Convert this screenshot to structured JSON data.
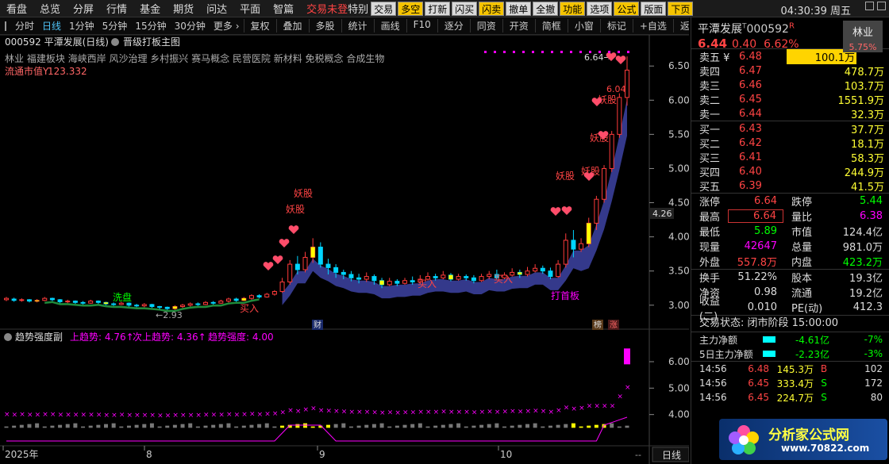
{
  "menubar": {
    "items": [
      "看盘",
      "总览",
      "分屏",
      "行情",
      "基金",
      "期货",
      "问达",
      "平面",
      "智篇"
    ],
    "trade_label": "交易",
    "trade_status": "未登",
    "trade_special": "特别",
    "toolbar": [
      {
        "label": "交易",
        "bg": "#d9d9d9"
      },
      {
        "label": "多空",
        "bg": "#f5c400"
      },
      {
        "label": "打新",
        "bg": "#d9d9d9"
      },
      {
        "label": "闪买",
        "bg": "#d9d9d9"
      },
      {
        "label": "闪卖",
        "bg": "#f5c400"
      },
      {
        "label": "撤单",
        "bg": "#d9d9d9"
      },
      {
        "label": "全撤",
        "bg": "#d9d9d9"
      },
      {
        "label": "功能",
        "bg": "#f5c400"
      },
      {
        "label": "选项",
        "bg": "#d9d9d9"
      },
      {
        "label": "公式",
        "bg": "#f5c400"
      },
      {
        "label": "版面",
        "bg": "#d9d9d9"
      },
      {
        "label": "下页",
        "bg": "#f5c400"
      }
    ],
    "clock": "04:30:39 周五"
  },
  "periodbar": {
    "periods": [
      "分时",
      "日线",
      "1分钟",
      "5分钟",
      "15分钟",
      "30分钟",
      "更多 ›"
    ],
    "active": "日线",
    "tools": [
      "复权",
      "叠加",
      "多股",
      "统计",
      "画线",
      "F10",
      "逐分",
      "同资",
      "开资",
      "简框",
      "小窗",
      "标记",
      "+自选",
      "返回"
    ]
  },
  "chart_info": {
    "code_name": "000592 平潭发展(日线)",
    "formula": "晋级打板主图",
    "concepts": "林业 福建板块 海峡西岸 风沙治理 乡村振兴 赛马概念 民营医院 新材料 免税概念 合成生物",
    "market_cap_label": "流通市值Y",
    "market_cap_value": "123.332",
    "price_now": "4.26",
    "high_label": "6.64",
    "low_label": "2.93",
    "mark_604": "6.04"
  },
  "annotations": {
    "yaogu": "妖股",
    "buy": "买入",
    "xipan": "洗盘",
    "dashouban": "打首板",
    "cai": "财",
    "bang": "榜",
    "zhang": "涨"
  },
  "indicator": {
    "name": "趋势强度副",
    "up_label": "上趋势:",
    "up_value": "4.76↑",
    "next_label": "次上趋势:",
    "next_value": "4.36↑",
    "strength_label": "趋势强度:",
    "strength_value": "4.00"
  },
  "axis": {
    "main_ticks": [
      "6.50",
      "6.00",
      "5.50",
      "5.00",
      "4.50",
      "4.00",
      "3.50",
      "3.00"
    ],
    "sub_ticks": [
      "6.00",
      "5.00",
      "4.00"
    ],
    "x_labels": [
      "2025年",
      "8",
      "9",
      "10"
    ],
    "period_label": "日线",
    "pager": "--"
  },
  "chart_data": {
    "type": "candlestick",
    "ylim": [
      2.8,
      6.7
    ],
    "candles": [
      [
        3.08,
        3.1,
        3.06,
        3.12
      ],
      [
        3.09,
        3.07,
        3.05,
        3.11
      ],
      [
        3.07,
        3.08,
        3.05,
        3.1
      ],
      [
        3.08,
        3.06,
        3.04,
        3.09
      ],
      [
        3.06,
        3.07,
        3.04,
        3.09
      ],
      [
        3.07,
        3.1,
        3.06,
        3.12
      ],
      [
        3.1,
        3.08,
        3.06,
        3.11
      ],
      [
        3.08,
        3.05,
        3.03,
        3.09
      ],
      [
        3.05,
        3.06,
        3.03,
        3.08
      ],
      [
        3.06,
        3.04,
        3.02,
        3.07
      ],
      [
        3.04,
        3.03,
        3.01,
        3.06
      ],
      [
        3.03,
        3.06,
        3.02,
        3.08
      ],
      [
        3.06,
        3.04,
        3.02,
        3.07
      ],
      [
        3.04,
        3.02,
        3.0,
        3.05
      ],
      [
        3.02,
        3.01,
        2.99,
        3.04
      ],
      [
        3.01,
        3.03,
        3.0,
        3.05
      ],
      [
        3.03,
        3.0,
        2.98,
        3.04
      ],
      [
        3.0,
        2.99,
        2.97,
        3.02
      ],
      [
        2.99,
        3.01,
        2.97,
        3.03
      ],
      [
        3.01,
        2.98,
        2.96,
        3.02
      ],
      [
        2.98,
        2.97,
        2.94,
        2.99
      ],
      [
        2.97,
        2.95,
        2.93,
        2.98
      ],
      [
        2.95,
        2.98,
        2.93,
        3.0
      ],
      [
        2.98,
        3.0,
        2.96,
        3.02
      ],
      [
        3.0,
        3.02,
        2.98,
        3.04
      ],
      [
        3.02,
        3.01,
        2.99,
        3.04
      ],
      [
        3.01,
        3.04,
        3.0,
        3.06
      ],
      [
        3.04,
        3.03,
        3.01,
        3.06
      ],
      [
        3.03,
        3.06,
        3.02,
        3.08
      ],
      [
        3.06,
        3.09,
        3.04,
        3.11
      ],
      [
        3.09,
        3.07,
        3.05,
        3.11
      ],
      [
        3.07,
        3.1,
        3.06,
        3.12
      ],
      [
        3.1,
        3.14,
        3.08,
        3.16
      ],
      [
        3.14,
        3.12,
        3.1,
        3.16
      ],
      [
        3.12,
        3.16,
        3.11,
        3.18
      ],
      [
        3.16,
        3.2,
        3.14,
        3.22
      ],
      [
        3.2,
        3.34,
        3.18,
        3.4
      ],
      [
        3.34,
        3.6,
        3.3,
        3.66
      ],
      [
        3.6,
        3.52,
        3.45,
        3.72
      ],
      [
        3.52,
        3.7,
        3.48,
        3.78
      ],
      [
        3.7,
        3.85,
        3.62,
        3.98
      ],
      [
        3.85,
        3.6,
        3.55,
        3.92
      ],
      [
        3.6,
        3.55,
        3.45,
        3.68
      ],
      [
        3.55,
        3.48,
        3.4,
        3.6
      ],
      [
        3.48,
        3.45,
        3.38,
        3.52
      ],
      [
        3.45,
        3.4,
        3.35,
        3.5
      ],
      [
        3.4,
        3.38,
        3.32,
        3.46
      ],
      [
        3.38,
        3.42,
        3.34,
        3.48
      ],
      [
        3.42,
        3.36,
        3.3,
        3.45
      ],
      [
        3.36,
        3.3,
        3.25,
        3.4
      ],
      [
        3.3,
        3.35,
        3.28,
        3.4
      ],
      [
        3.35,
        3.32,
        3.28,
        3.38
      ],
      [
        3.32,
        3.36,
        3.3,
        3.4
      ],
      [
        3.36,
        3.34,
        3.3,
        3.42
      ],
      [
        3.34,
        3.38,
        3.32,
        3.44
      ],
      [
        3.38,
        3.42,
        3.36,
        3.48
      ],
      [
        3.42,
        3.4,
        3.36,
        3.46
      ],
      [
        3.4,
        3.44,
        3.38,
        3.5
      ],
      [
        3.44,
        3.38,
        3.35,
        3.47
      ],
      [
        3.38,
        3.42,
        3.36,
        3.46
      ],
      [
        3.42,
        3.4,
        3.36,
        3.45
      ],
      [
        3.4,
        3.36,
        3.32,
        3.44
      ],
      [
        3.36,
        3.42,
        3.34,
        3.46
      ],
      [
        3.42,
        3.45,
        3.38,
        3.5
      ],
      [
        3.45,
        3.4,
        3.38,
        3.52
      ],
      [
        3.4,
        3.44,
        3.38,
        3.48
      ],
      [
        3.44,
        3.48,
        3.42,
        3.54
      ],
      [
        3.48,
        3.45,
        3.4,
        3.52
      ],
      [
        3.45,
        3.5,
        3.42,
        3.56
      ],
      [
        3.5,
        3.54,
        3.48,
        3.6
      ],
      [
        3.54,
        3.5,
        3.46,
        3.58
      ],
      [
        3.5,
        3.42,
        3.38,
        3.55
      ],
      [
        3.42,
        3.6,
        3.4,
        3.66
      ],
      [
        3.6,
        3.95,
        3.55,
        4.05
      ],
      [
        3.95,
        3.82,
        3.7,
        4.1
      ],
      [
        3.82,
        3.9,
        3.78,
        3.98
      ],
      [
        3.9,
        4.2,
        3.85,
        4.28
      ],
      [
        4.2,
        4.55,
        4.1,
        4.6
      ],
      [
        4.55,
        5.0,
        4.5,
        5.05
      ],
      [
        5.0,
        5.5,
        4.95,
        5.55
      ],
      [
        5.5,
        6.04,
        5.45,
        6.1
      ],
      [
        6.04,
        6.44,
        5.92,
        6.64
      ]
    ]
  },
  "rightpanel": {
    "stock_name": "平潭发展",
    "stock_code": "000592",
    "industry": "林业",
    "industry_pct": "5.75%",
    "price": "6.44",
    "change": "0.40",
    "change_pct": "6.62%",
    "asks": [
      {
        "label": "卖五 ¥",
        "price": "6.48",
        "vol": "100.1万"
      },
      {
        "label": "卖四",
        "price": "6.47",
        "vol": "478.7万"
      },
      {
        "label": "卖三",
        "price": "6.46",
        "vol": "103.7万"
      },
      {
        "label": "卖二",
        "price": "6.45",
        "vol": "1551.9万"
      },
      {
        "label": "卖一",
        "price": "6.44",
        "vol": "32.3万"
      }
    ],
    "bids": [
      {
        "label": "买一",
        "price": "6.43",
        "vol": "37.7万"
      },
      {
        "label": "买二",
        "price": "6.42",
        "vol": "18.1万"
      },
      {
        "label": "买三",
        "price": "6.41",
        "vol": "58.3万"
      },
      {
        "label": "买四",
        "price": "6.40",
        "vol": "244.9万"
      },
      {
        "label": "买五",
        "price": "6.39",
        "vol": "41.5万"
      }
    ],
    "stats1": [
      {
        "k": "涨停",
        "v": "6.64",
        "vc": "#f44",
        "k2": "跌停",
        "v2": "5.44",
        "v2c": "#0f0"
      },
      {
        "k": "最高",
        "v": "6.64",
        "vc": "#f44",
        "k2": "量比",
        "v2": "6.38",
        "v2c": "#f0f"
      },
      {
        "k": "最低",
        "v": "5.89",
        "vc": "#0f0",
        "k2": "市值",
        "v2": "124.4亿",
        "v2c": "#ddd"
      },
      {
        "k": "现量",
        "v": "42647",
        "vc": "#f0f",
        "k2": "总量",
        "v2": "981.0万",
        "v2c": "#ddd"
      },
      {
        "k": "外盘",
        "v": "557.8万",
        "vc": "#f44",
        "k2": "内盘",
        "v2": "423.2万",
        "v2c": "#0f0"
      }
    ],
    "stats2": [
      {
        "k": "换手",
        "v": "51.22%",
        "vc": "#ddd",
        "k2": "股本",
        "v2": "19.3亿",
        "v2c": "#ddd"
      },
      {
        "k": "净资",
        "v": "0.98",
        "vc": "#ddd",
        "k2": "流通",
        "v2": "19.2亿",
        "v2c": "#ddd"
      },
      {
        "k": "收益(二)",
        "v": "0.010",
        "vc": "#ddd",
        "k2": "PE(动)",
        "v2": "412.3",
        "v2c": "#ddd"
      }
    ],
    "trade_status": "交易状态: 闭市阶段 15:00:00",
    "flows": [
      {
        "k": "主力净额",
        "v": "-4.61亿",
        "p": "-7%"
      },
      {
        "k": "5日主力净额",
        "v": "-2.23亿",
        "p": "-3%"
      }
    ],
    "ticks": [
      {
        "t": "14:56",
        "p": "6.48",
        "v": "145.3万",
        "s": "B",
        "sc": "#f44",
        "n": "102"
      },
      {
        "t": "14:56",
        "p": "6.45",
        "v": "333.4万",
        "s": "S",
        "sc": "#0f0",
        "n": "172"
      },
      {
        "t": "14:56",
        "p": "6.45",
        "v": "224.7万",
        "s": "S",
        "sc": "#0f0",
        "n": "80"
      }
    ]
  },
  "watermark": {
    "title": "分析家公式网",
    "url": "www.70822.com"
  }
}
